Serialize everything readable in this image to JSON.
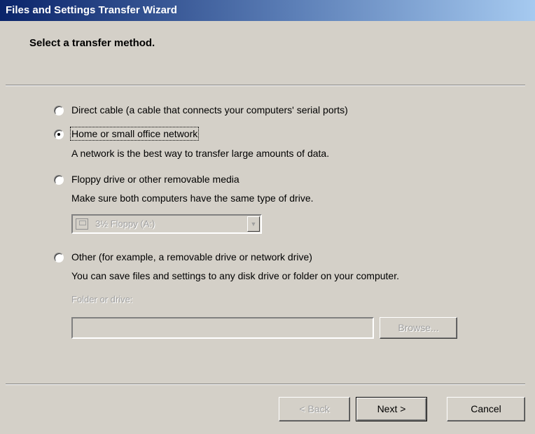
{
  "window": {
    "title": "Files and Settings Transfer Wizard"
  },
  "header": {
    "title": "Select a transfer method."
  },
  "options": [
    {
      "label": "Direct cable (a cable that connects your computers' serial ports)",
      "description": "",
      "selected": false
    },
    {
      "label": "Home or small office network",
      "description": "A network is the best way to transfer large amounts of data.",
      "selected": true
    },
    {
      "label": "Floppy drive or other removable media",
      "description": "Make sure both computers have the same type of drive.",
      "selected": false
    },
    {
      "label": "Other (for example, a removable drive or network drive)",
      "description": "You can save files and settings to any disk drive or folder on your computer.",
      "selected": false
    }
  ],
  "floppy_drive": {
    "selected_value": "3½ Floppy (A:)",
    "icon": "floppy-drive-icon",
    "enabled": false
  },
  "folder": {
    "label": "Folder or drive:",
    "value": "",
    "browse_label": "Browse...",
    "enabled": false
  },
  "footer": {
    "back_label": "< Back",
    "next_label": "Next >",
    "cancel_label": "Cancel",
    "back_enabled": false
  },
  "colors": {
    "title_bar_start": "#0a246a",
    "title_bar_end": "#a6caf0",
    "dialog_face": "#d4d0c8",
    "disabled_text": "#a0a0a0"
  }
}
